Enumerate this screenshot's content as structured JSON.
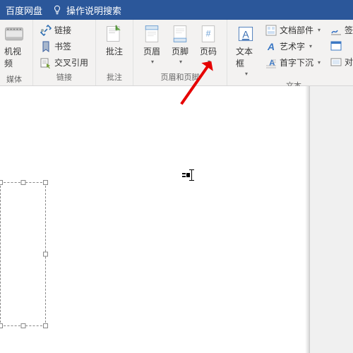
{
  "titlebar": {
    "app_name": "百度网盘",
    "help_search": "操作说明搜索"
  },
  "ribbon": {
    "media_partial": {
      "item": "机视频",
      "group_label": "媒体"
    },
    "links": {
      "link": "链接",
      "bookmark": "书签",
      "cross_ref": "交叉引用",
      "group_label": "链接"
    },
    "comments": {
      "comment": "批注",
      "group_label": "批注"
    },
    "header_footer": {
      "header": "页眉",
      "footer": "页脚",
      "page_number": "页码",
      "group_label": "页眉和页脚"
    },
    "text": {
      "text_box": "文本框",
      "quick_parts": "文档部件",
      "word_art": "艺术字",
      "drop_cap": "首字下沉",
      "sig_partial": "签",
      "obj_partial": "对",
      "group_label": "文本"
    }
  }
}
